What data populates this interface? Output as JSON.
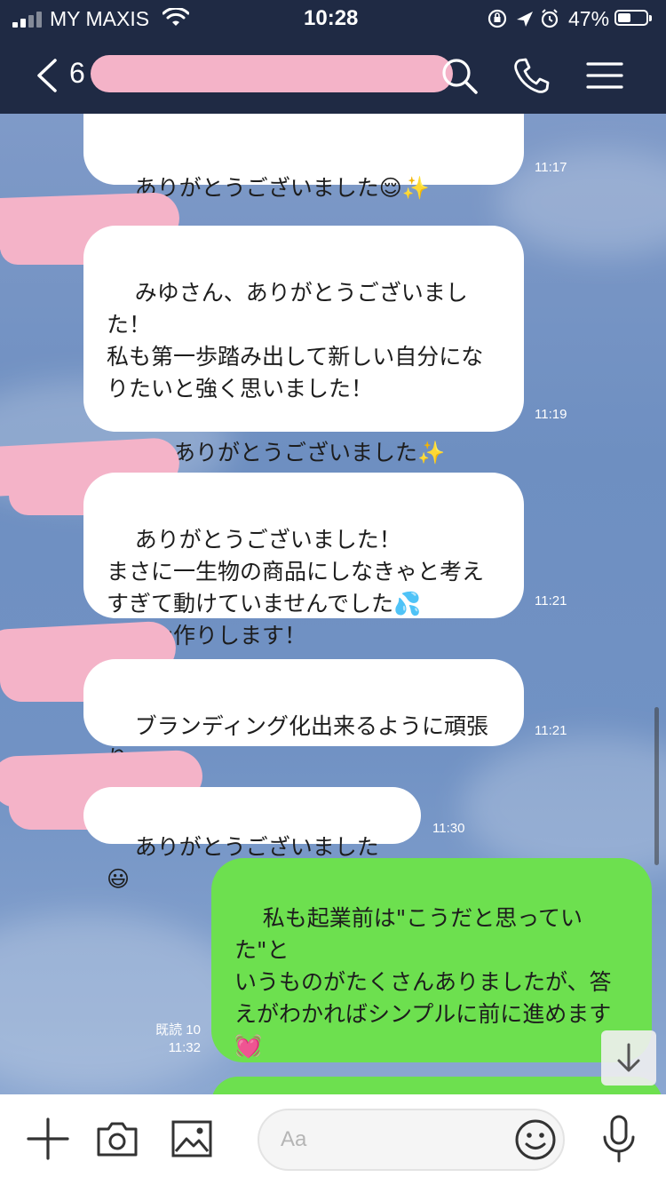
{
  "status_bar": {
    "carrier": "MY MAXIS",
    "time": "10:28",
    "battery_percent": "47%",
    "battery_level": 0.47
  },
  "header": {
    "back_count": "6",
    "icons": [
      "search-icon",
      "phone-icon",
      "menu-icon"
    ]
  },
  "messages": [
    {
      "side": "left",
      "text": "ありがとうございました😌✨",
      "time": "11:17"
    },
    {
      "side": "left",
      "text": "みゆさん、ありがとうございました！\n私も第一歩踏み出して新しい自分にな\nりたいと強く思いました！\n\n本当にありがとうございました✨",
      "time": "11:19"
    },
    {
      "side": "left",
      "text": "ありがとうございました！\nまさに一生物の商品にしなきゃと考え\nすぎて動けていませんでした💦\nファン作りします！",
      "time": "11:21"
    },
    {
      "side": "left",
      "text": "ブランディング化出来るように頑張り\nます！",
      "time": "11:21"
    },
    {
      "side": "left",
      "text": "ありがとうございました😃",
      "time": "11:30"
    },
    {
      "side": "right",
      "text": "私も起業前は\"こうだと思っていた\"と\nいうものがたくさんありましたが、答\nえがわかればシンプルに前に進めます\n💓\n\n最高の人生にしていきましょう✨",
      "read_label": "既読 10",
      "time": "11:32"
    }
  ],
  "input": {
    "placeholder": "Aa",
    "icons": [
      "plus-icon",
      "camera-icon",
      "image-icon",
      "emoji-icon",
      "microphone-icon"
    ]
  },
  "colors": {
    "header_bg": "#1f2a44",
    "my_bubble": "#6de04f",
    "their_bubble": "#ffffff",
    "redaction": "#f4b3c8"
  }
}
